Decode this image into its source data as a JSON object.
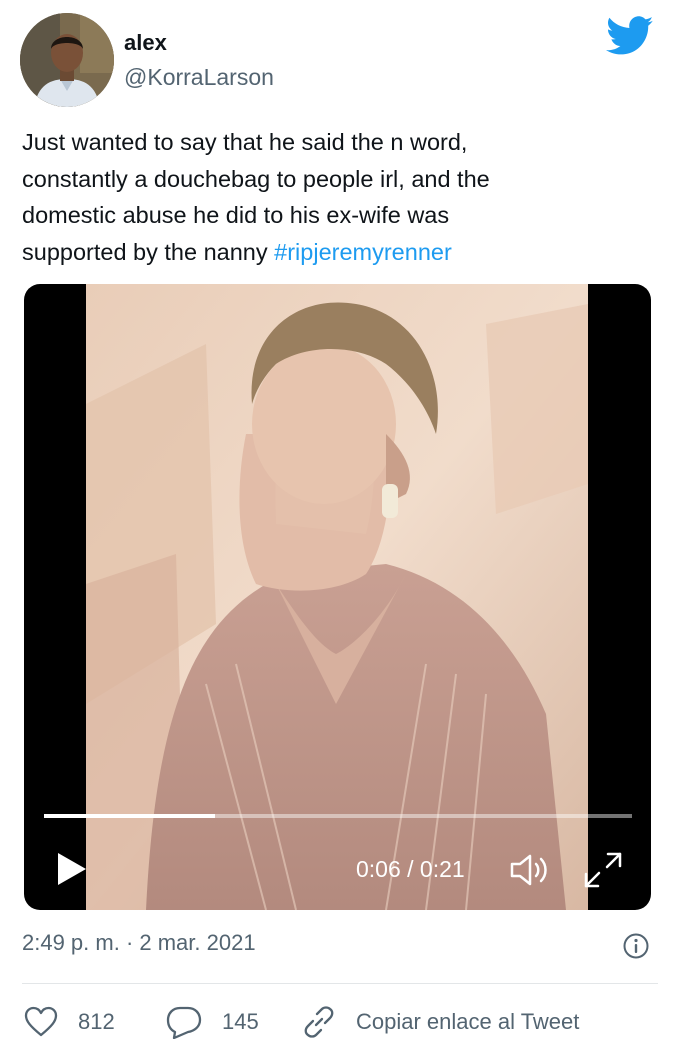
{
  "user": {
    "display_name": "alex",
    "handle": "@KorraLarson"
  },
  "tweet": {
    "lines": [
      "Just wanted to say that he said the n word,",
      "constantly a douchebag to people irl, and the",
      "domestic abuse he did to his ex-wife was"
    ],
    "last_line_text": "supported by the nanny ",
    "hashtag": "#ripjeremyrenner"
  },
  "video": {
    "time": "0:06 / 0:21",
    "progress": 0.29
  },
  "meta": {
    "timestamp": "2:49 p. m. · 2 mar. 2021"
  },
  "actions": {
    "likes": "812",
    "replies": "145",
    "copy_link_label": "Copiar enlace al Tweet"
  },
  "colors": {
    "accent": "#1d9bf0",
    "secondary_text": "#536471"
  },
  "icons": [
    "twitter-logo-icon",
    "play-icon",
    "volume-icon",
    "fullscreen-icon",
    "info-icon",
    "heart-icon",
    "reply-icon",
    "link-icon"
  ]
}
